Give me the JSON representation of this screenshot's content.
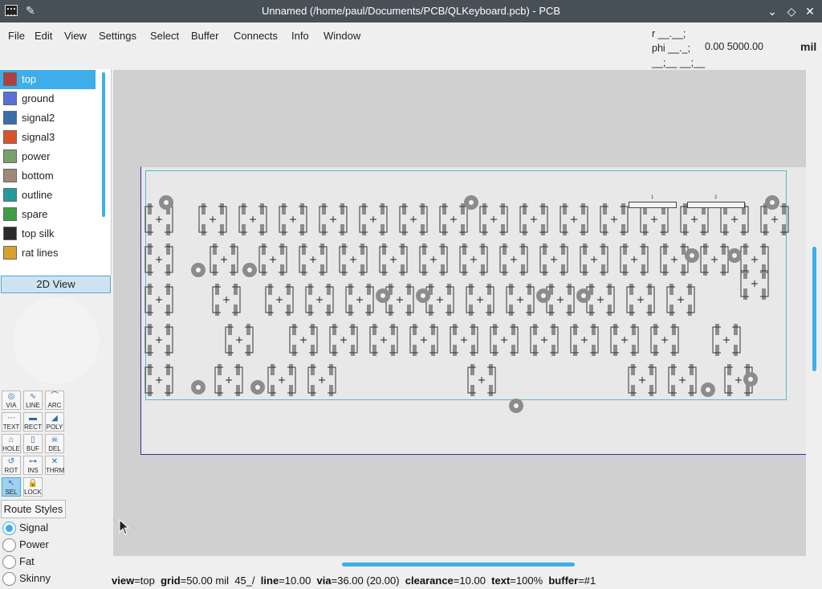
{
  "window": {
    "title": "Unnamed (/home/paul/Documents/PCB/QLKeyboard.pcb) - PCB",
    "controls": [
      "minimize",
      "restore",
      "close"
    ]
  },
  "menu": [
    "File",
    "Edit",
    "View",
    "Settings",
    "Select",
    "Buffer",
    "Connects",
    "Info",
    "Window"
  ],
  "coords": {
    "r_label": "r __.__;",
    "phi_label": "phi __._;",
    "extra": "__;__ __;__",
    "value": "0.00 5000.00",
    "units": "mil"
  },
  "layers": [
    {
      "name": "top",
      "color": "#b04040",
      "selected": true
    },
    {
      "name": "ground",
      "color": "#5a6fd8"
    },
    {
      "name": "signal2",
      "color": "#3a6eab"
    },
    {
      "name": "signal3",
      "color": "#d9542a"
    },
    {
      "name": "power",
      "color": "#7aa06c"
    },
    {
      "name": "bottom",
      "color": "#9d8b78"
    },
    {
      "name": "outline",
      "color": "#239b9b"
    },
    {
      "name": "spare",
      "color": "#3f9e45"
    },
    {
      "name": "top silk",
      "color": "#2a2a2a"
    },
    {
      "name": "rat lines",
      "color": "#d6a12c"
    }
  ],
  "view2d_label": "2D View",
  "tools": [
    {
      "label": "VIA",
      "icon": "via-icon",
      "glyph": "◎"
    },
    {
      "label": "LINE",
      "icon": "line-icon",
      "glyph": "∿"
    },
    {
      "label": "ARC",
      "icon": "arc-icon",
      "glyph": "⌒"
    },
    {
      "label": "TEXT",
      "icon": "text-icon",
      "glyph": "⋯"
    },
    {
      "label": "RECT",
      "icon": "rect-icon",
      "glyph": "▬"
    },
    {
      "label": "POLY",
      "icon": "poly-icon",
      "glyph": "◢"
    },
    {
      "label": "HOLE",
      "icon": "hole-icon",
      "glyph": "⌂"
    },
    {
      "label": "BUF",
      "icon": "buffer-icon",
      "glyph": "▯"
    },
    {
      "label": "DEL",
      "icon": "delete-icon",
      "glyph": "☠"
    },
    {
      "label": "ROT",
      "icon": "rotate-icon",
      "glyph": "↺"
    },
    {
      "label": "INS",
      "icon": "insert-icon",
      "glyph": "⊶"
    },
    {
      "label": "THRM",
      "icon": "thermal-icon",
      "glyph": "✕"
    },
    {
      "label": "SEL",
      "icon": "select-icon",
      "glyph": "↖",
      "selected": true
    },
    {
      "label": "LOCK",
      "icon": "lock-icon",
      "glyph": "🔒"
    }
  ],
  "route_styles": {
    "title": "Route Styles",
    "options": [
      {
        "label": "Signal",
        "selected": true
      },
      {
        "label": "Power"
      },
      {
        "label": "Fat"
      },
      {
        "label": "Skinny"
      }
    ]
  },
  "board": {
    "header_labels": [
      "1",
      "2"
    ]
  },
  "status": {
    "view_k": "view",
    "view_v": "=top",
    "grid_k": "grid",
    "grid_v": "=50.00 mil",
    "angle": "45_/",
    "line_k": "line",
    "line_v": "=10.00",
    "via_k": "via",
    "via_v": "=36.00 (20.00)",
    "clearance_k": "clearance",
    "clearance_v": "=10.00",
    "text_k": "text",
    "text_v": "=100%",
    "buffer_k": "buffer",
    "buffer_v": "=#1"
  }
}
